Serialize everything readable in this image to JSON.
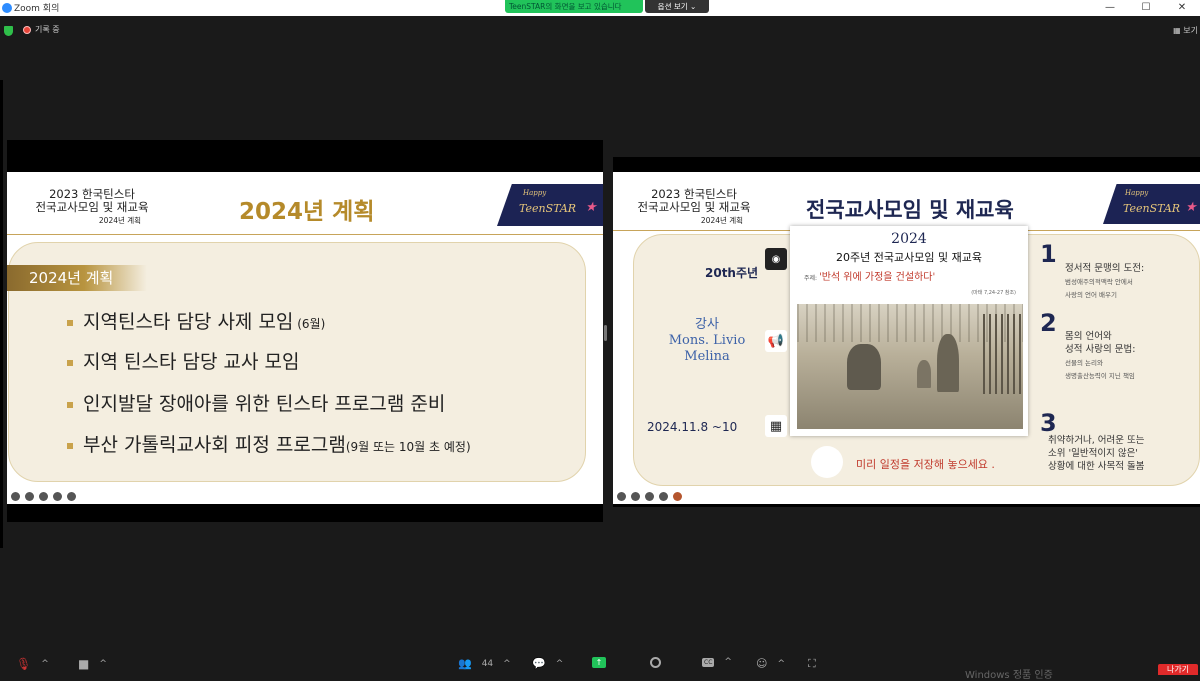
{
  "window": {
    "title": "Zoom 회의",
    "minimize": "—",
    "maximize": "☐",
    "close": "✕"
  },
  "share_banner": {
    "text": "TeenSTAR의 화면을 보고 있습니다",
    "view_options": "옵션 보기 ⌄"
  },
  "status": {
    "recording": "기록 중",
    "view": "보기"
  },
  "left_slide": {
    "header_line1": "2023 한국틴스타",
    "header_line2": "전국교사모임 및 재교육",
    "header_sub": "2024년 계획",
    "title": "2024년 계획",
    "tag": "2024년 계획",
    "bullets": [
      {
        "text": "지역틴스타 담당 사제 모임",
        "note": " (6월)"
      },
      {
        "text": "지역 틴스타 담당 교사 모임",
        "note": ""
      },
      {
        "text": "인지발달 장애아를 위한 틴스타 프로그램 준비",
        "note": ""
      },
      {
        "text": "부산 가톨릭교사회 피정 프로그램",
        "note": "(9월 또는 10월 초 예정)"
      }
    ],
    "logo": {
      "happy": "Happy",
      "name": "TeenSTAR",
      "star": "★"
    }
  },
  "right_slide": {
    "header_line1": "2023 한국틴스타",
    "header_line2": "전국교사모임 및 재교육",
    "header_sub": "2024년 계획",
    "title": "전국교사모임 및 재교육",
    "logo": {
      "happy": "Happy",
      "name": "TeenSTAR",
      "star": "★"
    },
    "card": {
      "year": "2024",
      "title": "20주년 전국교사모임 및 재교육",
      "theme_label": "주제: ",
      "theme": "'반석 위에 가정을 건설하다'",
      "ref": "(마태 7,24-27 참조)"
    },
    "anniversary": "20th주년",
    "speaker_label": "강사",
    "speaker_name1": "Mons. Livio",
    "speaker_name2": "Melina",
    "date": "2024.11.8 ~10",
    "save_note": "미리 일정을 저장해 놓으세요 .",
    "points": [
      {
        "num": "1",
        "line1": "정서적 문맹의 도전:",
        "fine1": "범성애주의적맥락 안에서",
        "fine2": "사랑의 언어 배우기"
      },
      {
        "num": "2",
        "line1": "몸의 언어와",
        "line2": "성적 사랑의 문법:",
        "fine1": "선물의 논리와",
        "fine2": "생명출산능력이 지닌 책임"
      },
      {
        "num": "3",
        "line1": "취약하거나, 어려운 또는",
        "line2": "소위 '일반적이지 않은'",
        "line3": "상황에 대한 사목적 돌봄"
      }
    ]
  },
  "toolbar": {
    "participants_count": "44",
    "watermark": "Windows 정품 인증",
    "leave": "나가기"
  },
  "colors": {
    "brand_blue": "#2d8cff",
    "share_green": "#21c35a",
    "leave_red": "#e02a2a",
    "gold": "#b58a2a",
    "navy": "#1e2752"
  }
}
